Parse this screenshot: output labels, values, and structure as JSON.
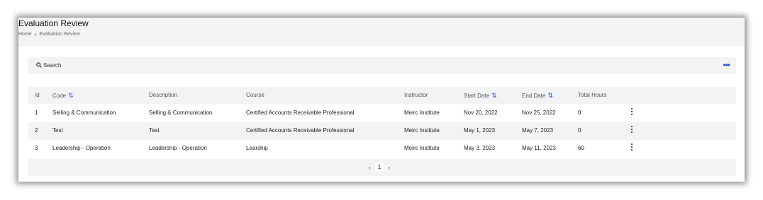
{
  "page": {
    "title": "Evaluation Review",
    "breadcrumb": [
      "Home",
      "Evaluation Review"
    ]
  },
  "search": {
    "placeholder": "Search"
  },
  "table": {
    "columns": [
      "Id",
      "Code",
      "Description",
      "Course",
      "Instructor",
      "Start Date",
      "End Date",
      "Total Hours"
    ],
    "rows": [
      {
        "id": "1",
        "code": "Selling & Communication",
        "description": "Selling & Communication",
        "course": "Certified Accounts Receivable Professional",
        "instructor": "Meirc Institute",
        "start_date": "Nov 20, 2022",
        "end_date": "Nov 25, 2022",
        "total_hours": "0"
      },
      {
        "id": "2",
        "code": "Test",
        "description": "Test",
        "course": "Certified Accounts Receivable Professional",
        "instructor": "Meirc Institute",
        "start_date": "May 1, 2023",
        "end_date": "May 7, 2023",
        "total_hours": "0"
      },
      {
        "id": "3",
        "code": "Leadership - Operation",
        "description": "Leadership - Operation",
        "course": "Learship",
        "instructor": "Meirc Institute",
        "start_date": "May 3, 2023",
        "end_date": "May 11, 2023",
        "total_hours": "60"
      }
    ]
  },
  "pagination": {
    "current_page": "1"
  },
  "icons": {
    "search": "search-icon",
    "more": "more-horizontal-icon",
    "sort": "sort-icon",
    "row_menu": "more-vertical-icon",
    "prev": "chevron-left-icon",
    "next": "chevron-right-icon"
  },
  "colors": {
    "accent": "#2a55c8",
    "header_bg": "#f4f4f4",
    "row_alt_bg": "#f3f3f3"
  }
}
